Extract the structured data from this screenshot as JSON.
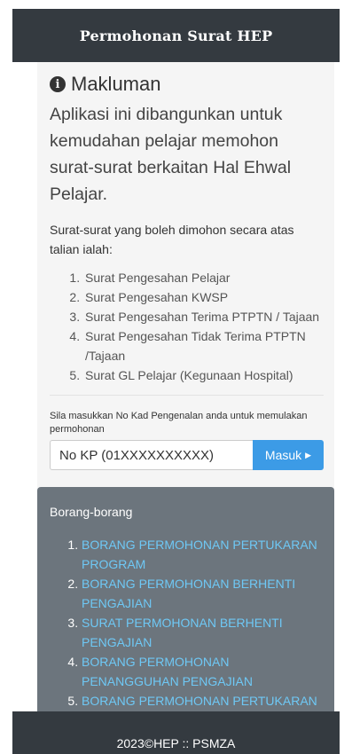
{
  "header": {
    "title": "Permohonan Surat HEP"
  },
  "notice": {
    "heading": "Makluman",
    "lead": "Aplikasi ini dibangunkan untuk kemudahan pelajar memohon surat-surat berkaitan Hal Ehwal Pelajar.",
    "subtitle": "Surat-surat yang boleh dimohon secara atas talian ialah:",
    "letters": [
      "Surat Pengesahan Pelajar",
      "Surat Pengesahan KWSP",
      "Surat Pengesahan Terima PTPTN / Tajaan",
      "Surat Pengesahan Tidak Terima PTPTN /Tajaan",
      "Surat GL Pelajar (Kegunaan Hospital)"
    ]
  },
  "login": {
    "prompt": "Sila masukkan No Kad Pengenalan anda untuk memulakan permohonan",
    "placeholder": "No KP (01XXXXXXXXXX)",
    "button_label": "Masuk"
  },
  "forms": {
    "title": "Borang-borang",
    "items": [
      "BORANG PERMOHONAN PERTUKARAN PROGRAM",
      "BORANG PERMOHONAN BERHENTI PENGAJIAN",
      "SURAT PERMOHONAN BERHENTI PENGAJIAN",
      "BORANG PERMOHONAN PENANGGUHAN PENGAJIAN",
      "BORANG PERMOHONAN PERTUKARAN"
    ]
  },
  "footer": {
    "text": "2023©HEP :: PSMZA"
  },
  "colors": {
    "header_bg": "#343a40",
    "card_bg": "#6c757d",
    "button": "#3c9be6",
    "link": "#6ec8f5"
  },
  "icons": {
    "notice": "info-circle-icon",
    "button": "caret-right-icon"
  }
}
